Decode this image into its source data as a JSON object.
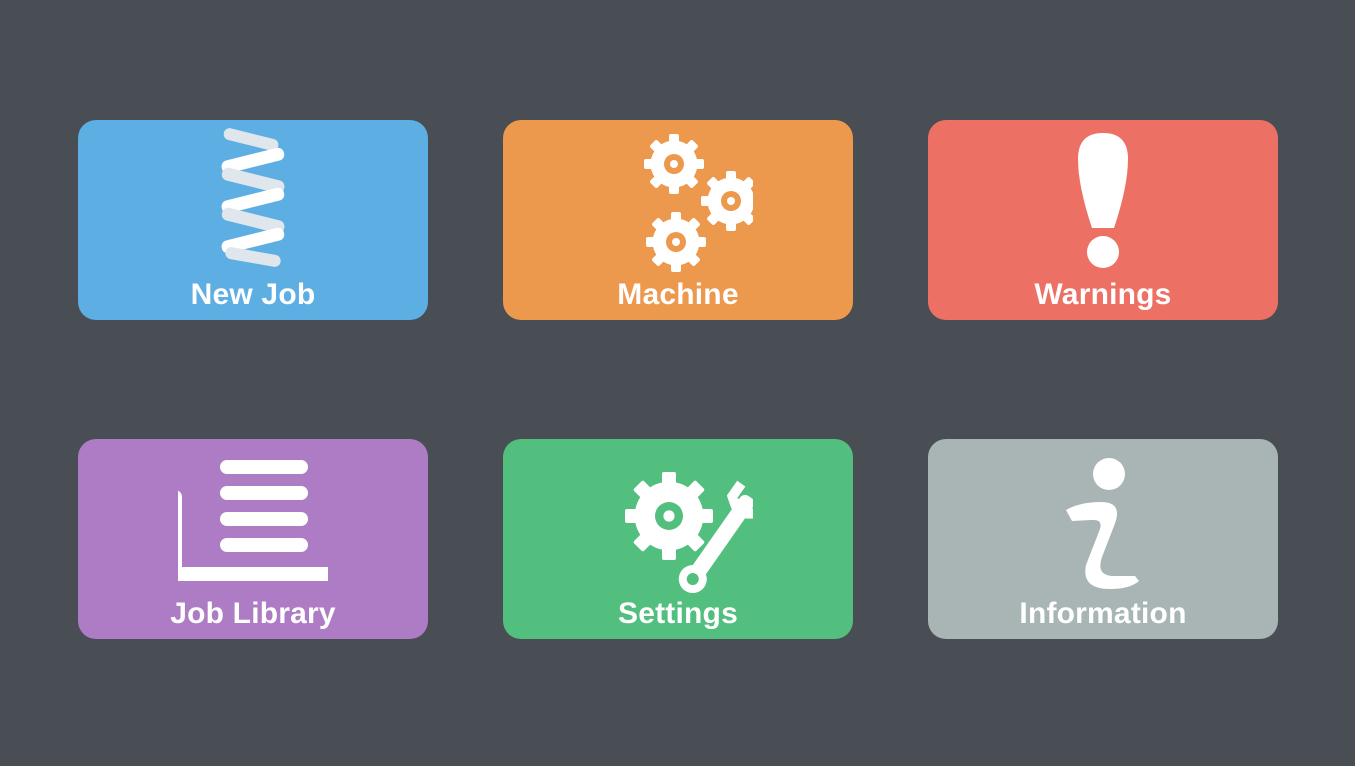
{
  "tiles": {
    "new_job": {
      "label": "New Job",
      "color": "#5daee2",
      "icon": "spring-icon"
    },
    "machine": {
      "label": "Machine",
      "color": "#ec984d",
      "icon": "gears-icon"
    },
    "warnings": {
      "label": "Warnings",
      "color": "#ed7064",
      "icon": "exclamation-icon"
    },
    "job_library": {
      "label": "Job Library",
      "color": "#ad7cc5",
      "icon": "library-tray-icon"
    },
    "settings": {
      "label": "Settings",
      "color": "#52bf7e",
      "icon": "gear-wrench-icon"
    },
    "information": {
      "label": "Information",
      "color": "#a9b5b5",
      "icon": "info-icon"
    }
  },
  "theme": {
    "background": "#494e55",
    "text_color": "#ffffff"
  }
}
